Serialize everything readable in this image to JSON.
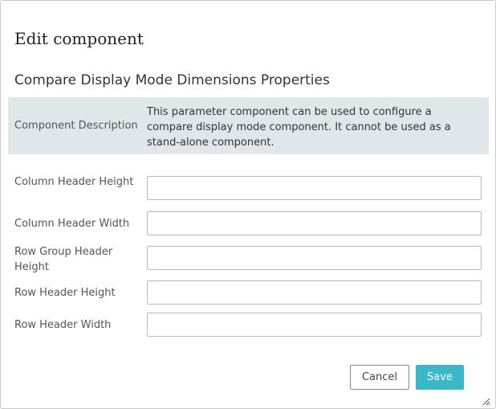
{
  "dialog": {
    "title": "Edit component"
  },
  "section": {
    "title": "Compare Display Mode Dimensions Properties"
  },
  "description": {
    "label": "Component Description",
    "text": "This parameter component can be used to configure a compare display mode component. It cannot be used as a stand-alone component."
  },
  "fields": [
    {
      "label": "Column Header Height",
      "value": "",
      "placeholder": ""
    },
    {
      "label": "Column Header Width",
      "value": "",
      "placeholder": ""
    },
    {
      "label": "Row Group Header Height",
      "value": "",
      "placeholder": ""
    },
    {
      "label": "Row Header Height",
      "value": "",
      "placeholder": ""
    },
    {
      "label": "Row Header Width",
      "value": "",
      "placeholder": ""
    }
  ],
  "buttons": {
    "cancel_label": "Cancel",
    "save_label": "Save"
  },
  "colors": {
    "accent": "#3bb8c8",
    "description_background": "#e0e7ea"
  },
  "icons": {
    "resize": "resize-grip-icon"
  }
}
